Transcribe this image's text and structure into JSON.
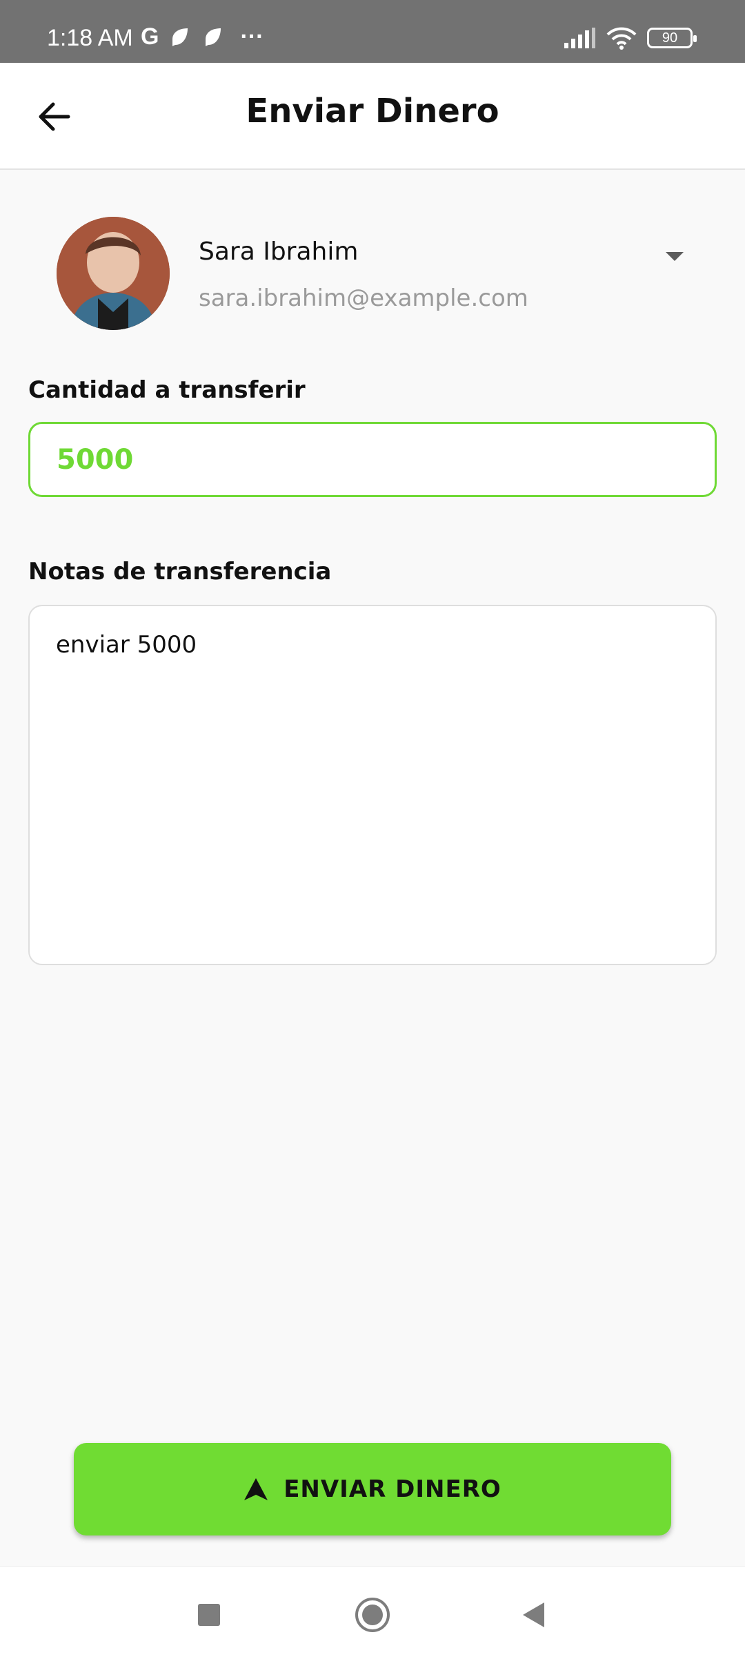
{
  "status_bar": {
    "time": "1:18 AM",
    "carrier_letter": "G",
    "overflow": "···",
    "battery": "90",
    "icons": [
      "leaf-icon",
      "leaf-icon",
      "signal-icon",
      "wifi-icon",
      "battery-icon"
    ]
  },
  "app_bar": {
    "title": "Enviar Dinero",
    "back_icon": "arrow-left-icon"
  },
  "recipient": {
    "name": "Sara Ibrahim",
    "email": "sara.ibrahim@example.com",
    "dropdown_icon": "caret-down-icon"
  },
  "amount": {
    "label": "Cantidad a transferir",
    "value": "5000"
  },
  "notes": {
    "label": "Notas de transferencia",
    "value": "enviar 5000"
  },
  "send_button": {
    "label": "ENVIAR DINERO",
    "icon": "send-icon"
  },
  "colors": {
    "accent": "#70dc33",
    "status_bar": "#727272",
    "background": "#f9f9f9"
  },
  "nav_bar": {
    "icons": [
      "square-icon",
      "circle-home-icon",
      "triangle-back-icon"
    ]
  }
}
